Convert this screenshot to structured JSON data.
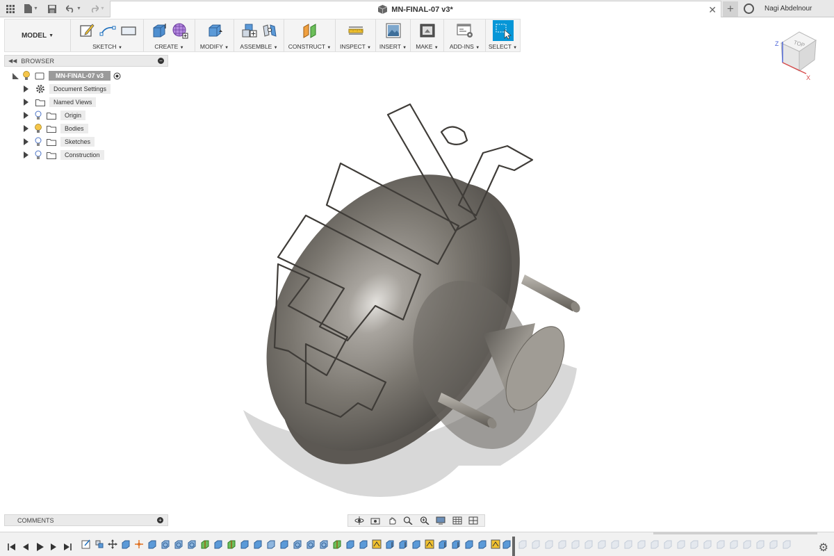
{
  "app": {
    "doc_title": "MN-FINAL-07 v3*",
    "user_name": "Nagi Abdelnour"
  },
  "ribbon": {
    "workspace": "MODEL",
    "groups": [
      {
        "label": "SKETCH",
        "icons": [
          "sketch-edit-icon",
          "line-icon",
          "rectangle-icon"
        ]
      },
      {
        "label": "CREATE",
        "icons": [
          "extrude-box-icon",
          "form-sphere-icon"
        ]
      },
      {
        "label": "MODIFY",
        "icons": [
          "press-pull-icon"
        ]
      },
      {
        "label": "ASSEMBLE",
        "icons": [
          "new-component-icon",
          "joint-icon"
        ]
      },
      {
        "label": "CONSTRUCT",
        "icons": [
          "offset-plane-icon"
        ]
      },
      {
        "label": "INSPECT",
        "icons": [
          "measure-icon"
        ]
      },
      {
        "label": "INSERT",
        "icons": [
          "insert-image-icon"
        ]
      },
      {
        "label": "MAKE",
        "icons": [
          "3d-print-icon"
        ]
      },
      {
        "label": "ADD-INS",
        "icons": [
          "scripts-icon"
        ]
      },
      {
        "label": "SELECT",
        "icons": [
          "select-window-icon"
        ]
      }
    ]
  },
  "viewcube": {
    "face": "TOP",
    "axes": [
      "Z",
      "X"
    ]
  },
  "browser": {
    "title": "BROWSER",
    "root": "MN-FINAL-07 v3",
    "items": [
      {
        "label": "Document Settings",
        "icon": "gear-icon"
      },
      {
        "label": "Named Views",
        "icon": "folder-icon"
      },
      {
        "label": "Origin",
        "icon": "folder-icon"
      },
      {
        "label": "Bodies",
        "icon": "folder-icon"
      },
      {
        "label": "Sketches",
        "icon": "folder-icon"
      },
      {
        "label": "Construction",
        "icon": "folder-icon"
      }
    ]
  },
  "comments": {
    "title": "COMMENTS"
  },
  "nav": {
    "icons": [
      "orbit-icon",
      "look-at-icon",
      "pan-icon",
      "zoom-icon",
      "zoom-window-icon",
      "display-settings-icon",
      "grid-icon",
      "viewports-icon"
    ]
  },
  "colors": {
    "accent": "#0696d7",
    "model_metal": "#77736d",
    "ribbon_bg": "#f4f4f4"
  }
}
